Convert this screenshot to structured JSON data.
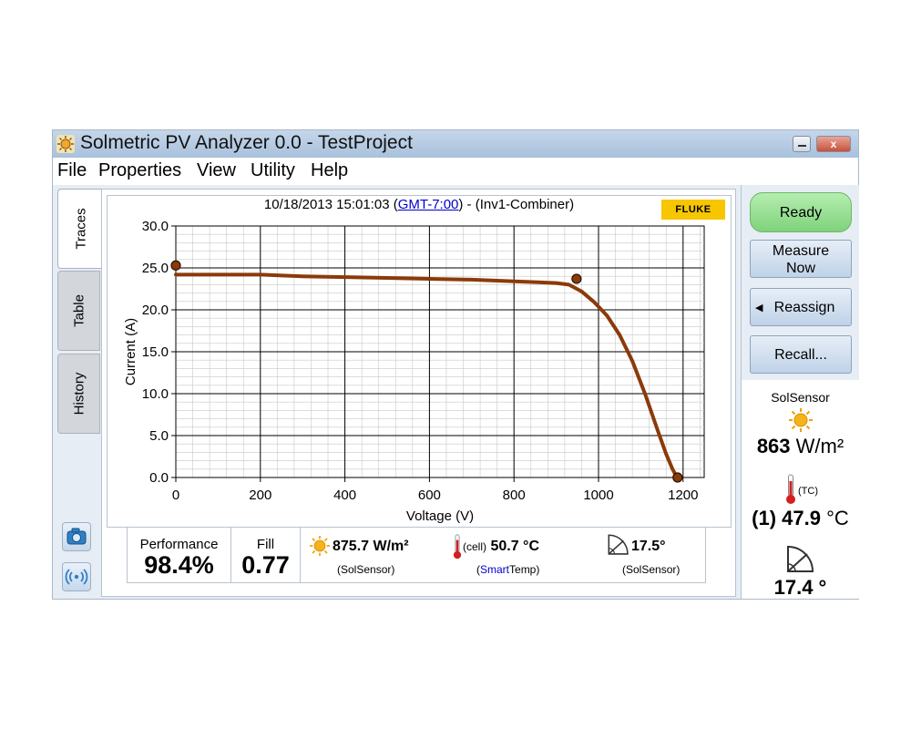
{
  "window": {
    "title": "Solmetric PV Analyzer 0.0 - TestProject",
    "close_label": "x"
  },
  "menu": [
    "File",
    "Properties",
    "View",
    "Utility",
    "Help"
  ],
  "tabs": [
    "Traces",
    "Table",
    "History"
  ],
  "header": {
    "timestamp": "10/18/2013 15:01:03 (",
    "timezone": "GMT-7:00",
    "suffix": ") - (Inv1-Combiner)",
    "logo_text": "FLUKE"
  },
  "chart_data": {
    "type": "line",
    "xlabel": "Voltage (V)",
    "ylabel": "Current (A)",
    "xlim": [
      0,
      1250
    ],
    "ylim": [
      0,
      30
    ],
    "x_ticks": [
      "0",
      "200",
      "400",
      "600",
      "800",
      "1000",
      "1200"
    ],
    "y_ticks": [
      "0.0",
      "5.0",
      "10.0",
      "15.0",
      "20.0",
      "25.0",
      "30.0"
    ],
    "grid": true,
    "series": [
      {
        "color": "#8b3a0a",
        "x": [
          0,
          100,
          200,
          300,
          400,
          500,
          600,
          700,
          800,
          850,
          900,
          930,
          960,
          990,
          1020,
          1050,
          1080,
          1110,
          1140,
          1160,
          1175,
          1185
        ],
        "y": [
          24.2,
          24.2,
          24.2,
          24.0,
          23.9,
          23.8,
          23.7,
          23.6,
          23.4,
          23.3,
          23.2,
          23.0,
          22.2,
          20.9,
          19.3,
          17.0,
          13.9,
          10.0,
          5.6,
          2.8,
          1.0,
          0.1
        ]
      }
    ],
    "markers": [
      {
        "x": 0,
        "y": 25.3
      },
      {
        "x": 948,
        "y": 23.7
      },
      {
        "x": 1187,
        "y": 0.0
      }
    ]
  },
  "stats": {
    "performance_label": "Performance",
    "performance_value": "98.4%",
    "fill_label": "Fill",
    "fill_value": "0.77",
    "irradiance_value": "875.7 W/m²",
    "irradiance_source": "(SolSensor)",
    "cell_prefix": "(cell)",
    "cell_value": "50.7 °C",
    "cell_source_brand": "Smart",
    "cell_source_rest": "Temp)",
    "cell_source_open": "(",
    "tilt_value": "17.5°",
    "tilt_source": "(SolSensor)"
  },
  "right": {
    "ready_label": "Ready",
    "measure_line1": "Measure",
    "measure_line2": "Now",
    "reassign_label": "Reassign",
    "recall_label": "Recall...",
    "sensor_title": "SolSensor",
    "irradiance_value": "863",
    "irradiance_unit": "W/m²",
    "tc_label": "(TC)",
    "temp_value": "(1) 47.9",
    "temp_unit": "°C",
    "tilt_value": "17.4 °"
  },
  "colors": {
    "curve": "#8b3a0a",
    "ready": "#8fdc8a",
    "link": "#0000cc",
    "fluke": "#f7c600"
  }
}
